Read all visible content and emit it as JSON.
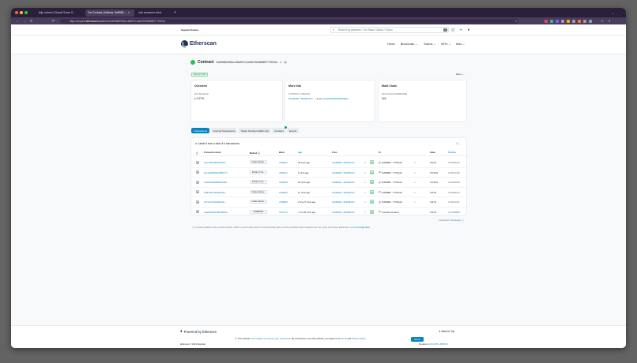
{
  "browser": {
    "tabs": [
      {
        "title": "(bij) contract | Etapa2 Sosen S..."
      },
      {
        "title": "Ton Contract | Address: 0x6f983..."
      },
      {
        "title": "ohai seesamer client"
      }
    ],
    "new_tab": "+",
    "url_prefix": "https://sepolia.",
    "url_domain": "etherscan.io",
    "url_path": "/address/0x6f98820f5ec1f6af97c1a4619318888f77 7f2e3a"
  },
  "topbar": {
    "network_label": "Sepolia Testnet",
    "search_placeholder": "Search by Address / Txn Hash / Block / Token",
    "search_kbd": "/"
  },
  "nav": {
    "brand": "Etherscan",
    "items": [
      {
        "label": "Home"
      },
      {
        "label": "Blockchain ⌄"
      },
      {
        "label": "Tokens ⌄"
      },
      {
        "label": "NFTs ⌄"
      },
      {
        "label": "Misc ⌄"
      }
    ]
  },
  "contract": {
    "title": "Contract",
    "address": "0x6f98820f5ec1f6af97c1a4619318888f777f2e3a",
    "sponsored": "Sponsor Code",
    "more": "More ⌄"
  },
  "overview": {
    "title": "Overview",
    "balance_label": "ETH BALANCE",
    "balance_value": "♦ 0 ETH"
  },
  "more_info": {
    "title": "More Info",
    "creator_label": "CONTRACT CREATOR",
    "creator_addr": "0xe90b8d...50236b4c3",
    "creator_at": "at txn",
    "creator_txn": "0xaa4f4f0d1f48ad5fb01..."
  },
  "multichain": {
    "title": "Multi Chain",
    "label": "MULTICHAIN ADDRESSES",
    "value": "N/A"
  },
  "page_tabs": [
    {
      "label": "Transactions"
    },
    {
      "label": "Internal Transactions"
    },
    {
      "label": "Token Transfers (ERC-20)"
    },
    {
      "label": "Contract"
    },
    {
      "label": "Events"
    }
  ],
  "table": {
    "latest": "Latest 6 from a total of 6 transactions",
    "headers": {
      "hash": "Transaction Hash",
      "method": "Method ⓘ",
      "block": "Block",
      "age": "Age",
      "from": "From",
      "to": "To",
      "value": "Value",
      "fee": "Txn Fee"
    },
    "rows": [
      {
        "hash": "0x1c1815d0259f44e0...",
        "method": "Create Campa...",
        "block": "4769041",
        "age": "49 secs ago",
        "from": "0xe90b8d...50236b4c3",
        "dir": "IN",
        "to": "0x6f9882...777f2e3a",
        "value": "0 ETH",
        "fee": "0.00090262"
      },
      {
        "hash": "0x13e29504a01995777...",
        "method": "Donate To Ca...",
        "block": "4769014",
        "age": "6 mins ago",
        "from": "0xe90b8d...50236b4c3",
        "dir": "IN",
        "to": "0x6f9882...777f2e3a",
        "value": "0.5 ETH",
        "fee": "0.00014436"
      },
      {
        "hash": "0xb21b8a8a9581301f8...",
        "method": "Donate To Ca...",
        "block": "4769026",
        "age": "26 mins ago",
        "from": "0xe90b8d...50236b4c3",
        "dir": "IN",
        "to": "0x6f9882...777f2e3a",
        "value": "0.5 ETH",
        "fee": "0.00025088"
      },
      {
        "hash": "0x9b78c4795f1ab20e...",
        "method": "Create Campa...",
        "block": "4769022",
        "age": "27 mins ago",
        "from": "0xe90b8d...50236b4c3",
        "dir": "IN",
        "to": "0x6f9882...777f2e3a",
        "value": "0 ETH",
        "fee": "0.00099222"
      },
      {
        "hash": "0x72ce797a6d0fa1fe...",
        "method": "Create Campa...",
        "block": "4768863",
        "age": "2 hrs 27 mins ago",
        "from": "0xe90b8d...50236b4c3",
        "dir": "IN",
        "to": "0x6f9882...777f2e3a",
        "value": "0 ETH",
        "fee": "0.00091911"
      },
      {
        "hash": "0xaa4f4f0d1f48ad5fb01...",
        "method": "0x60806040",
        "block": "4767272",
        "age": "7 hrs 30 mins ago",
        "from": "0xe90b8d...50236b4c3",
        "dir": "IN",
        "to": "Contract Creation",
        "value": "0 ETH",
        "fee": "0.00138888"
      }
    ]
  },
  "csv": {
    "prefix": "[ Download: ",
    "link": "CSV Export",
    "suffix": " ⤓ ]"
  },
  "note": {
    "text": "ⓘ A contract address hosts a smart contract, which is a set of code stored on the blockchain that runs when predetermined conditions are met. Learn more about addresses in our ",
    "link": "Knowledge Base."
  },
  "footer": {
    "powered": "Powered by Ethereum",
    "back_to_top": "⬆ Back to Top",
    "cookie_text_1": "ⓘ This website ",
    "cookie_link_1": "uses cookies to improve your experience.",
    "cookie_text_2": " By continuing to use this website, you agree to its ",
    "cookie_terms": "Terms",
    "cookie_and": " and ",
    "cookie_privacy": "Privacy Policy.",
    "got_it": "Got It!",
    "copyright": "Etherscan © 2023 (Sepolia)",
    "donations_label": "Donations: ",
    "donations_addr": "0x71c765...d8976f"
  }
}
